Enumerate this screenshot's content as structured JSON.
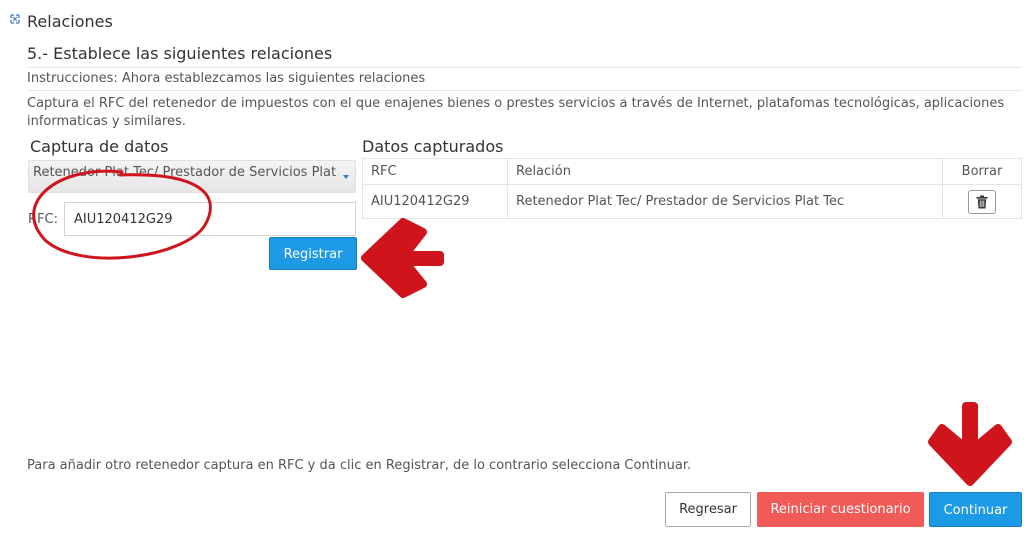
{
  "section": {
    "title": "Relaciones",
    "icon": "expand-icon"
  },
  "step": {
    "title": "5.- Establece las siguientes relaciones",
    "instructions": "Instrucciones: Ahora establezcamos las siguientes relaciones",
    "description": "Captura el RFC del retenedor de impuestos con el que enajenes bienes o prestes servicios a través de Internet, platafomas tecnológicas, aplicaciones informaticas y similares."
  },
  "capture": {
    "title": "Captura de datos",
    "select_value": "Retenedor Plat Tec/ Prestador de Servicios Plat",
    "rfc_label": "RFC:",
    "rfc_value": "AIU120412G29",
    "register_label": "Registrar"
  },
  "captured": {
    "title": "Datos capturados",
    "headers": {
      "rfc": "RFC",
      "relation": "Relación",
      "delete": "Borrar"
    },
    "rows": [
      {
        "rfc": "AIU120412G29",
        "relation": "Retenedor Plat Tec/ Prestador de Servicios Plat Tec"
      }
    ]
  },
  "footer": {
    "note": "Para añadir otro retenedor captura en RFC y da clic en Registrar, de lo contrario selecciona Continuar.",
    "back_label": "Regresar",
    "reset_label": "Reiniciar cuestionario",
    "continue_label": "Continuar"
  },
  "colors": {
    "primary": "#1d9ae6",
    "danger": "#f05a57",
    "annotation": "#d0141c"
  }
}
